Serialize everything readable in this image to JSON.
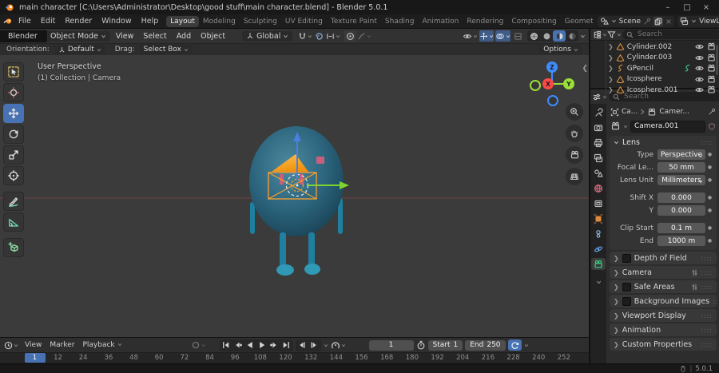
{
  "colors": {
    "accent": "#4772b3",
    "selection": "#ffa228",
    "egg_light": "#4d89a0",
    "egg_mid": "#2a637b",
    "egg_dark": "#173c4e",
    "limb": "#1f7fa0",
    "foot": "#2f99b6",
    "cone_light": "#ffc155",
    "cone": "#f0920f",
    "axis_x": "#ff4747",
    "axis_y": "#9ade3a",
    "axis_z": "#3f8cff",
    "arrow_green": "#7ed32f",
    "arrow_blue": "#4a7fe0",
    "pink": "#c75f7d",
    "viewport_bg": "#3b3b3b"
  },
  "titlebar": {
    "title": "main character [C:\\Users\\Administrator\\Desktop\\good stuff\\main character.blend] - Blender 5.0.1",
    "minimize": "–",
    "maximize": "□",
    "close": "×"
  },
  "topbar": {
    "menus": [
      "File",
      "Edit",
      "Render",
      "Window",
      "Help"
    ],
    "tabs": [
      "Layout",
      "Modeling",
      "Sculpting",
      "UV Editing",
      "Texture Paint",
      "Shading",
      "Animation",
      "Rendering",
      "Compositing",
      "Geomet"
    ],
    "active_tab": "Layout",
    "scene_label": "Scene",
    "viewlayer_label": "ViewLayer"
  },
  "viewport": {
    "popover": "Blender",
    "mode": "Object Mode",
    "menus": [
      "View",
      "Select",
      "Add",
      "Object"
    ],
    "orientation": "Global",
    "options": "Options",
    "tool_settings": {
      "orientation_label": "Orientation:",
      "orientation_value": "Default",
      "drag_label": "Drag:",
      "drag_value": "Select Box"
    },
    "overlay": {
      "line1": "User Perspective",
      "line2": "(1) Collection | Camera"
    },
    "gizmo_axes": {
      "x": "X",
      "y": "Y",
      "z": "Z"
    },
    "tools": [
      "select-box",
      "cursor",
      "move",
      "rotate",
      "scale",
      "transform",
      "annotate",
      "measure",
      "add-cube"
    ],
    "active_tool": "move",
    "shading_modes": [
      "wireframe",
      "solid",
      "material-preview",
      "rendered"
    ],
    "active_shading": "material-preview"
  },
  "outliner": {
    "search_placeholder": "Search",
    "items": [
      {
        "name": "Cylinder.002",
        "icon": "cone"
      },
      {
        "name": "Cylinder.003",
        "icon": "cone"
      },
      {
        "name": "GPencil",
        "icon": "gpencil",
        "extra_icon": "gpencil-data"
      },
      {
        "name": "Icosphere",
        "icon": "cone"
      },
      {
        "name": "Icosphere.001",
        "icon": "cone"
      }
    ]
  },
  "properties": {
    "search_placeholder": "Search",
    "breadcrumb": {
      "object": "Ca...",
      "data": "Camer..."
    },
    "name_value": "Camera.001",
    "tabs": [
      "tool",
      "render",
      "output",
      "view-layer",
      "scene",
      "world",
      "collection",
      "object",
      "constraints",
      "physics",
      "object-data"
    ],
    "active_tab": "object-data",
    "lens": {
      "title": "Lens",
      "rows": [
        {
          "label": "Type",
          "value": "Perspective",
          "dropdown": true
        },
        {
          "label": "Focal Le...",
          "value": "50 mm"
        },
        {
          "label": "Lens Unit",
          "value": "Millimeters",
          "dropdown": true
        },
        {
          "label": "Shift X",
          "value": "0.000",
          "gap": true
        },
        {
          "label": "Y",
          "value": "0.000"
        },
        {
          "label": "Clip Start",
          "value": "0.1 m",
          "gap": true
        },
        {
          "label": "End",
          "value": "1000 m"
        }
      ]
    },
    "panels": [
      {
        "title": "Depth of Field",
        "checkbox": true
      },
      {
        "title": "Camera",
        "sliders": true
      },
      {
        "title": "Safe Areas",
        "checkbox": true,
        "sliders": true
      },
      {
        "title": "Background Images",
        "checkbox": true
      },
      {
        "title": "Viewport Display"
      },
      {
        "title": "Animation"
      },
      {
        "title": "Custom Properties"
      }
    ]
  },
  "timeline": {
    "menus": [
      "View",
      "Marker",
      "Playback"
    ],
    "current_frame": "1",
    "start_label": "Start",
    "start_value": "1",
    "end_label": "End",
    "end_value": "250",
    "playhead_frame": 1,
    "ruler_frames": [
      1,
      12,
      24,
      36,
      48,
      60,
      72,
      84,
      96,
      108,
      120,
      132,
      144,
      156,
      168,
      180,
      192,
      204,
      216,
      228,
      240,
      252
    ]
  },
  "statusbar": {
    "version": "5.0.1"
  }
}
